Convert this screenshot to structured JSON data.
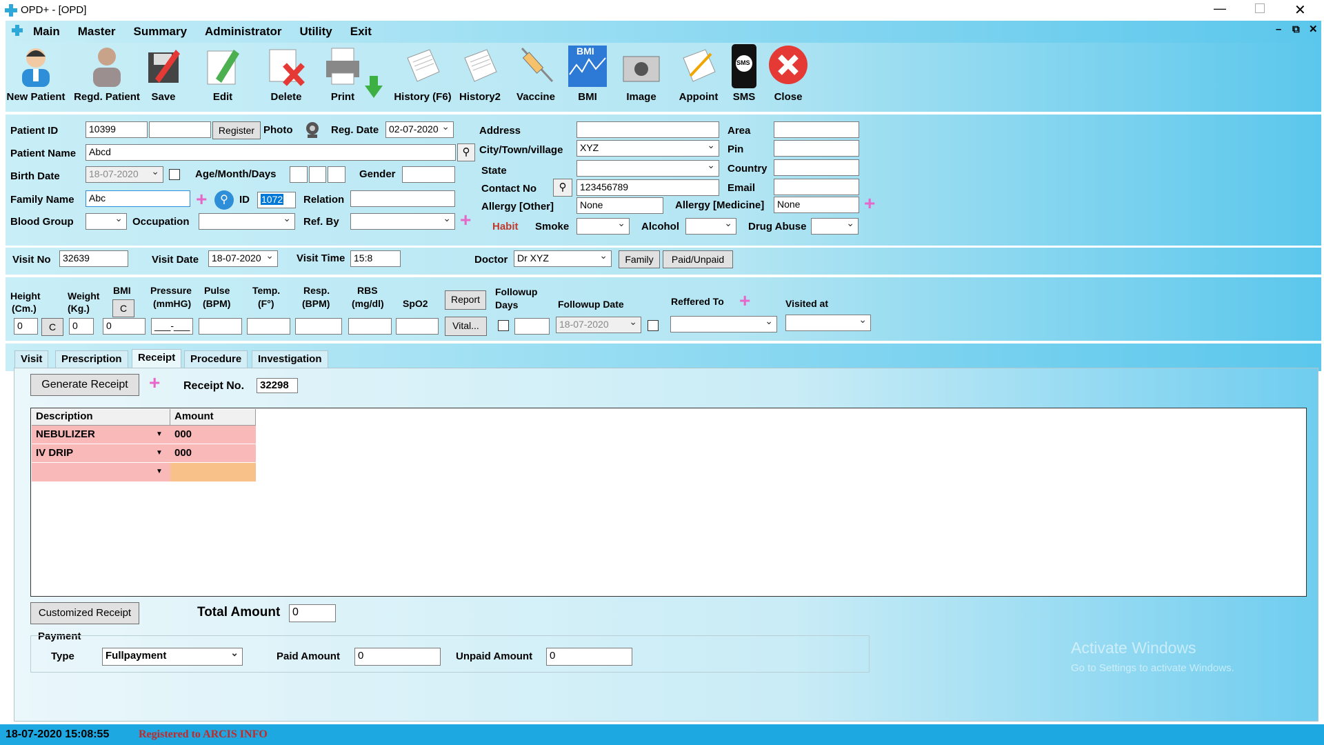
{
  "window": {
    "title": "OPD+ - [OPD]"
  },
  "menu": [
    "Main",
    "Master",
    "Summary",
    "Administrator",
    "Utility",
    "Exit"
  ],
  "toolbar": {
    "new_patient": "New Patient",
    "regd_patient": "Regd. Patient",
    "save": "Save",
    "edit": "Edit",
    "delete": "Delete",
    "print": "Print",
    "history": "History (F6)",
    "history2": "History2",
    "vaccine": "Vaccine",
    "bmi": "BMI",
    "bmi_badge": "BMI",
    "image": "Image",
    "appoint": "Appoint",
    "sms": "SMS",
    "sms_badge": "SMS",
    "close": "Close"
  },
  "patient": {
    "patient_id_label": "Patient ID",
    "patient_id": "10399",
    "register_button": "Register",
    "photo_label": "Photo",
    "reg_date_label": "Reg. Date",
    "reg_date": "02-07-2020",
    "patient_name_label": "Patient Name",
    "patient_name": "Abcd",
    "birth_date_label": "Birth Date",
    "birth_date": "18-07-2020",
    "age_label": "Age/Month/Days",
    "gender_label": "Gender",
    "family_name_label": "Family Name",
    "family_name": "Abc",
    "id_label": "ID",
    "id_value": "1072",
    "relation_label": "Relation",
    "blood_group_label": "Blood Group",
    "occupation_label": "Occupation",
    "ref_by_label": "Ref. By",
    "address_label": "Address",
    "city_label": "City/Town/village",
    "city": "XYZ",
    "state_label": "State",
    "contact_label": "Contact No",
    "contact": "123456789",
    "allergy_other_label": "Allergy [Other]",
    "allergy_other": "None",
    "allergy_medicine_label": "Allergy [Medicine]",
    "allergy_medicine": "None",
    "habit_label": "Habit",
    "smoke_label": "Smoke",
    "alcohol_label": "Alcohol",
    "drug_abuse_label": "Drug Abuse",
    "area_label": "Area",
    "pin_label": "Pin",
    "country_label": "Country",
    "email_label": "Email"
  },
  "visit": {
    "visit_no_label": "Visit No",
    "visit_no": "32639",
    "visit_date_label": "Visit Date",
    "visit_date": "18-07-2020",
    "visit_time_label": "Visit Time",
    "visit_time": "15:8",
    "doctor_label": "Doctor",
    "doctor": "Dr XYZ",
    "family_button": "Family",
    "paid_unpaid_button": "Paid/Unpaid"
  },
  "vitals": {
    "height_label_1": "Height",
    "height_label_2": "(Cm.)",
    "height": "0",
    "c_button": "C",
    "weight_label_1": "Weight",
    "weight_label_2": "(Kg.)",
    "weight": "0",
    "bmi_label": "BMI",
    "bmi_c_button": "C",
    "bmi": "0",
    "pressure_label_1": "Pressure",
    "pressure_label_2": "(mmHG)",
    "pressure": "___-___",
    "pulse_label_1": "Pulse",
    "pulse_label_2": "(BPM)",
    "temp_label_1": "Temp.",
    "temp_label_2": "(F°)",
    "resp_label_1": "Resp.",
    "resp_label_2": "(BPM)",
    "rbs_label_1": "RBS",
    "rbs_label_2": "(mg/dl)",
    "spo2_label": "SpO2",
    "report_button": "Report",
    "vital_button": "Vital...",
    "followup_days_label_1": "Followup",
    "followup_days_label_2": "Days",
    "followup_date_label": "Followup Date",
    "followup_date": "18-07-2020",
    "referred_to_label": "Reffered To",
    "visited_at_label": "Visited at"
  },
  "tabs": [
    "Visit",
    "Prescription",
    "Receipt",
    "Procedure",
    "Investigation"
  ],
  "receipt": {
    "generate_button": "Generate Receipt",
    "receipt_no_label": "Receipt No.",
    "receipt_no": "32298",
    "columns": [
      "Description",
      "Amount"
    ],
    "rows": [
      {
        "description": "NEBULIZER",
        "amount": "000"
      },
      {
        "description": "IV DRIP",
        "amount": "000"
      }
    ],
    "customized_button": "Customized Receipt",
    "total_label": "Total Amount",
    "total": "0",
    "payment_label": "Payment",
    "type_label": "Type",
    "type": "Fullpayment",
    "paid_label": "Paid Amount",
    "paid": "0",
    "unpaid_label": "Unpaid Amount",
    "unpaid": "0"
  },
  "watermark": {
    "line1": "Activate Windows",
    "line2": "Go to Settings to activate Windows."
  },
  "status": {
    "datetime": "18-07-2020 15:08:55",
    "registered": "Registered to ARCIS INFO"
  },
  "colors": {
    "panel_light": "#c8eef7",
    "panel_dark": "#5bc7ec",
    "row_pink": "#f9b9b9",
    "row_orange": "#f8c18a",
    "status_bar": "#1da8e1",
    "habit_red": "#c0392b",
    "accent_plus": "#e766c9"
  }
}
